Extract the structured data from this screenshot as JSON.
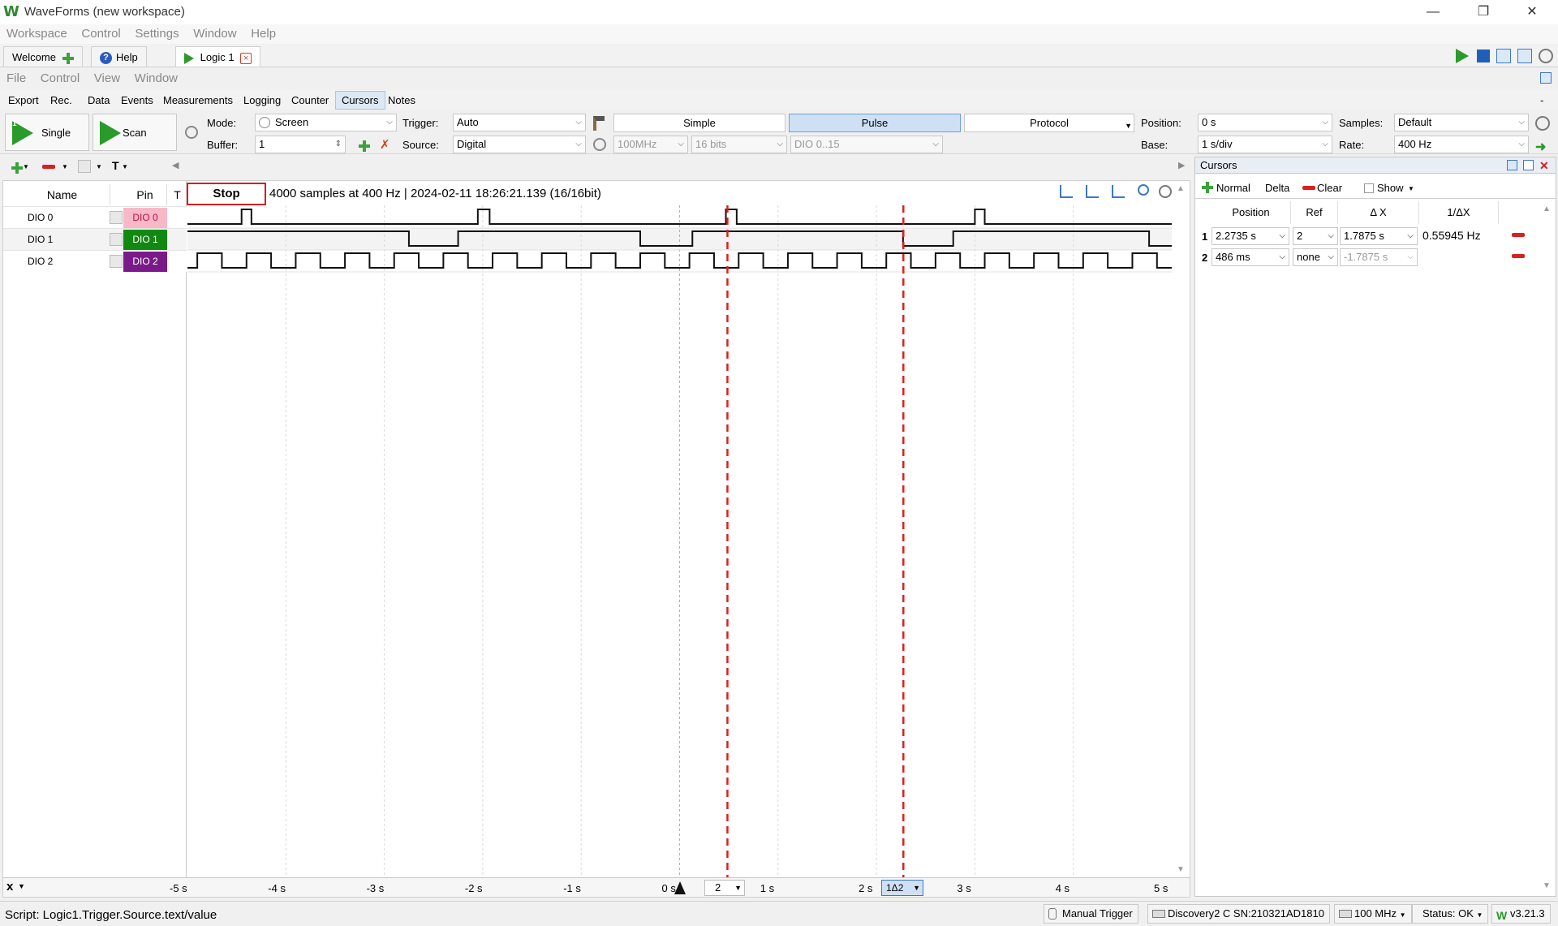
{
  "app": {
    "title": "WaveForms (new workspace)"
  },
  "main_menu": [
    "Workspace",
    "Control",
    "Settings",
    "Window",
    "Help"
  ],
  "workspace_tabs": [
    {
      "label": "Welcome"
    },
    {
      "label": "Help"
    },
    {
      "label": "Logic 1"
    }
  ],
  "instrument_menu": [
    "File",
    "Control",
    "View",
    "Window"
  ],
  "sub_menu": [
    "Export",
    "Rec.",
    "Data",
    "Events",
    "Measurements",
    "Logging",
    "Counter",
    "Cursors",
    "Notes"
  ],
  "sub_menu_selected": "Cursors",
  "toolbar": {
    "single_label": "Single",
    "scan_label": "Scan",
    "mode_label": "Mode:",
    "mode_value": "Screen",
    "buffer_label": "Buffer:",
    "buffer_value": "1",
    "trigger_label": "Trigger:",
    "trigger_value": "Auto",
    "source_label": "Source:",
    "source_value": "Digital",
    "clock_value": "100MHz",
    "bits_value": "16 bits",
    "dio_value": "DIO 0..15",
    "trigger_tabs": [
      "Simple",
      "Pulse",
      "Protocol"
    ],
    "trigger_tab_selected": "Pulse",
    "position_label": "Position:",
    "position_value": "0 s",
    "base_label": "Base:",
    "base_value": "1 s/div",
    "samples_label": "Samples:",
    "samples_value": "Default",
    "rate_label": "Rate:",
    "rate_value": "400 Hz"
  },
  "plot": {
    "stop_label": "Stop",
    "acquisition_info": "4000 samples at 400 Hz | 2024-02-11 18:26:21.139 (16/16bit)",
    "columns": {
      "name": "Name",
      "pin": "Pin",
      "trigger": "T"
    },
    "signals": [
      {
        "name": "DIO 0",
        "pin": "DIO  0",
        "pin_color": "#f8b8c8",
        "pin_text_color": "#c01040"
      },
      {
        "name": "DIO 1",
        "pin": "DIO  1",
        "pin_color": "#118811",
        "pin_text_color": "#ffffff"
      },
      {
        "name": "DIO 2",
        "pin": "DIO  2",
        "pin_color": "#7a1a8a",
        "pin_text_color": "#ffffff"
      }
    ],
    "x_axis": {
      "axis_label": "x",
      "ticks": [
        "-5 s",
        "-4 s",
        "-3 s",
        "-2 s",
        "-1 s",
        "0 s",
        "1 s",
        "2 s",
        "3 s",
        "4 s",
        "5 s"
      ],
      "cursor_ref_value": "2",
      "cursor_delta_label": "1Δ2"
    },
    "waveforms": {
      "time_range": [
        -5,
        5
      ],
      "dio0_pulses": [
        [
          -4.45,
          -4.35
        ],
        [
          -2.05,
          -1.93
        ],
        [
          0.47,
          0.58
        ],
        [
          3.0,
          3.1
        ]
      ],
      "dio1_low": [
        [
          -2.75,
          -2.25
        ],
        [
          -0.4,
          0.13
        ],
        [
          2.27,
          2.78
        ],
        [
          4.77,
          5.0
        ]
      ],
      "dio2_period_s": 0.5,
      "dio2_high_start": -4.9
    },
    "cursors_s": [
      0.486,
      2.2735
    ]
  },
  "cursors_panel": {
    "title": "Cursors",
    "toolbar": {
      "normal": "Normal",
      "delta": "Delta",
      "clear": "Clear",
      "show": "Show"
    },
    "columns": [
      "Position",
      "Ref",
      "Δ X",
      "1/ΔX"
    ],
    "rows": [
      {
        "index": "1",
        "position": "2.2735 s",
        "ref": "2",
        "dx": "1.7875 s",
        "inv_dx": "0.55945 Hz"
      },
      {
        "index": "2",
        "position": "486 ms",
        "ref": "none",
        "dx": "-1.7875 s",
        "inv_dx": ""
      }
    ]
  },
  "status_bar": {
    "script": "Script: Logic1.Trigger.Source.text/value",
    "manual_trigger": "Manual Trigger",
    "device": "Discovery2 C SN:210321AD1810",
    "clock": "100 MHz",
    "status": "Status: OK",
    "version": "v3.21.3"
  },
  "colors": {
    "accent": "#2a9a2a",
    "cursor": "#e02020",
    "selected_bg": "#cfe0f5"
  }
}
